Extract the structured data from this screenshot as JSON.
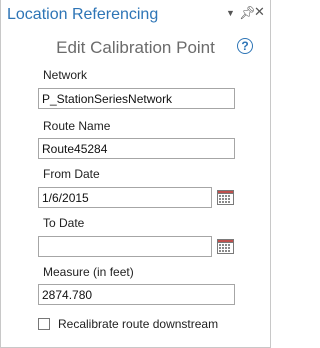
{
  "pane": {
    "title": "Location Referencing",
    "window_controls": [
      "dropdown-arrow-icon",
      "pin-icon",
      "close-icon"
    ],
    "title_color": "#2e75b6"
  },
  "form": {
    "heading": "Edit Calibration Point",
    "help_glyph": "?",
    "network": {
      "label": "Network",
      "value": "P_StationSeriesNetwork"
    },
    "route_name": {
      "label": "Route Name",
      "value": "Route45284"
    },
    "from_date": {
      "label": "From Date",
      "value": "1/6/2015"
    },
    "to_date": {
      "label": "To Date",
      "value": ""
    },
    "measure": {
      "label": "Measure (in feet)",
      "value": "2874.780"
    },
    "recalibrate": {
      "label": "Recalibrate route downstream",
      "checked": false
    }
  }
}
